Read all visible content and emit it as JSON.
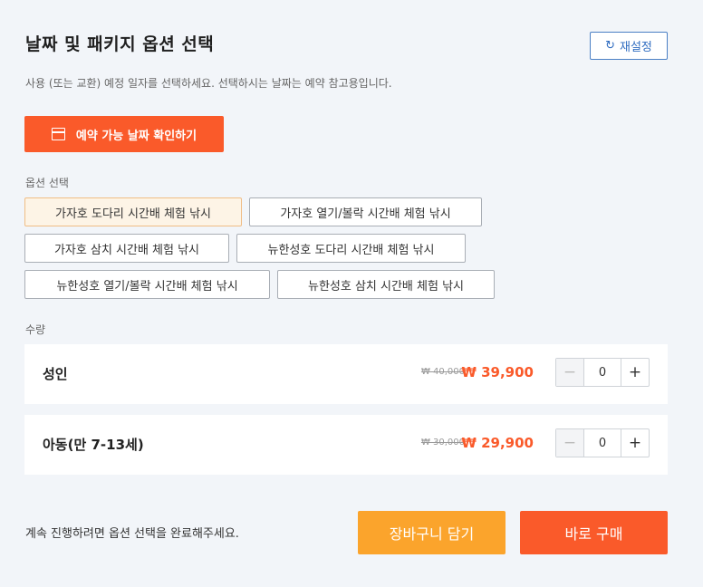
{
  "header": {
    "title": "날짜 및 패키지 옵션 선택",
    "reset_icon": "refresh-icon",
    "reset_label": "재설정"
  },
  "date": {
    "description": "사용 (또는 교환) 예정 일자를 선택하세요. 선택하시는 날짜는 예약 참고용입니다.",
    "button_icon": "calendar-icon",
    "button_label": "예약 가능 날짜 확인하기"
  },
  "options": {
    "label": "옵션 선택",
    "items": [
      {
        "label": "가자호 도다리 시간배 체험 낚시",
        "selected": true
      },
      {
        "label": "가자호 열기/볼락 시간배 체험 낚시",
        "selected": false
      },
      {
        "label": "가자호 삼치 시간배 체험 낚시",
        "selected": false
      },
      {
        "label": "뉴한성호 도다리 시간배 체험 낚시",
        "selected": false
      },
      {
        "label": "뉴한성호 열기/볼락 시간배 체험 낚시",
        "selected": false
      },
      {
        "label": "뉴한성호 삼치 시간배 체험 낚시",
        "selected": false
      }
    ]
  },
  "quantity": {
    "label": "수량",
    "rows": [
      {
        "name": "성인",
        "original_price": "₩ 40,000",
        "sale_price": "₩ 39,900",
        "qty": "0",
        "minus": "−",
        "plus": "+"
      },
      {
        "name": "아동(만 7-13세)",
        "original_price": "₩ 30,000",
        "sale_price": "₩ 29,900",
        "qty": "0",
        "minus": "−",
        "plus": "+"
      }
    ]
  },
  "footer": {
    "message": "계속 진행하려면 옵션 선택을 완료해주세요.",
    "cart_label": "장바구니 담기",
    "buy_label": "바로 구매"
  },
  "colors": {
    "accent": "#fa5a2a",
    "cart": "#fba42c",
    "link": "#2f6cc0",
    "background": "#f2f5f9"
  }
}
